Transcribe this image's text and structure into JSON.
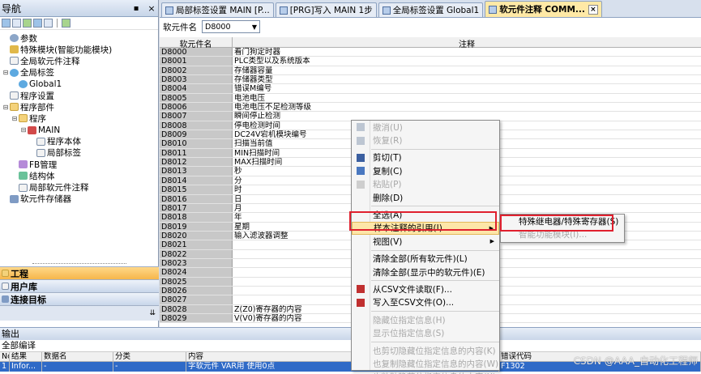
{
  "nav": {
    "title": "导航",
    "pin": "▪ ×",
    "tree": [
      {
        "label": "参数",
        "indent": 0,
        "toggle": "",
        "icon": "gear"
      },
      {
        "label": "特殊模块(智能功能模块)",
        "indent": 0,
        "toggle": "",
        "icon": "spec"
      },
      {
        "label": "全局软元件注释",
        "indent": 0,
        "toggle": "",
        "icon": "doc"
      },
      {
        "label": "全局标签",
        "indent": 0,
        "toggle": "-",
        "icon": "globe"
      },
      {
        "label": "Global1",
        "indent": 1,
        "toggle": "",
        "icon": "globe"
      },
      {
        "label": "程序设置",
        "indent": 0,
        "toggle": "",
        "icon": "doc"
      },
      {
        "label": "程序部件",
        "indent": 0,
        "toggle": "-",
        "icon": "folder"
      },
      {
        "label": "程序",
        "indent": 1,
        "toggle": "-",
        "icon": "folder"
      },
      {
        "label": "MAIN",
        "indent": 2,
        "toggle": "-",
        "icon": "prog"
      },
      {
        "label": "程序本体",
        "indent": 3,
        "toggle": "",
        "icon": "doc"
      },
      {
        "label": "局部标签",
        "indent": 3,
        "toggle": "",
        "icon": "doc"
      },
      {
        "label": "FB管理",
        "indent": 1,
        "toggle": "",
        "icon": "fb"
      },
      {
        "label": "结构体",
        "indent": 1,
        "toggle": "",
        "icon": "struct"
      },
      {
        "label": "局部软元件注释",
        "indent": 1,
        "toggle": "",
        "icon": "doc"
      },
      {
        "label": "软元件存储器",
        "indent": 0,
        "toggle": "",
        "icon": "mem"
      }
    ],
    "tabs": [
      {
        "label": "工程",
        "active": true
      },
      {
        "label": "用户库",
        "active": false
      },
      {
        "label": "连接目标",
        "active": false
      }
    ],
    "footer": "⇊"
  },
  "tabs": [
    {
      "label": "局部标签设置 MAIN [P...",
      "active": false
    },
    {
      "label": "[PRG]写入 MAIN 1步",
      "active": false
    },
    {
      "label": "全局标签设置 Global1",
      "active": false
    },
    {
      "label": "软元件注释 COMM...",
      "active": true
    }
  ],
  "selector": {
    "label": "软元件名",
    "value": "D8000"
  },
  "grid": {
    "col1": "软元件名",
    "col2": "注释",
    "rows": [
      {
        "dev": "D8000",
        "comment": "看门狗定时器"
      },
      {
        "dev": "D8001",
        "comment": "PLC类型以及系统版本"
      },
      {
        "dev": "D8002",
        "comment": "存储器容量"
      },
      {
        "dev": "D8003",
        "comment": "存储器类型"
      },
      {
        "dev": "D8004",
        "comment": "错误M编号"
      },
      {
        "dev": "D8005",
        "comment": "电池电压"
      },
      {
        "dev": "D8006",
        "comment": "电池电压不足检测等级"
      },
      {
        "dev": "D8007",
        "comment": "瞬间停止检测"
      },
      {
        "dev": "D8008",
        "comment": "停电检测时间"
      },
      {
        "dev": "D8009",
        "comment": "DC24V宕机模块编号"
      },
      {
        "dev": "D8010",
        "comment": "扫描当前值"
      },
      {
        "dev": "D8011",
        "comment": "MIN扫描时间"
      },
      {
        "dev": "D8012",
        "comment": "MAX扫描时间"
      },
      {
        "dev": "D8013",
        "comment": "秒"
      },
      {
        "dev": "D8014",
        "comment": "分"
      },
      {
        "dev": "D8015",
        "comment": "时"
      },
      {
        "dev": "D8016",
        "comment": "日"
      },
      {
        "dev": "D8017",
        "comment": "月"
      },
      {
        "dev": "D8018",
        "comment": "年"
      },
      {
        "dev": "D8019",
        "comment": "星期"
      },
      {
        "dev": "D8020",
        "comment": "输入滤波器调整"
      },
      {
        "dev": "D8021",
        "comment": ""
      },
      {
        "dev": "D8022",
        "comment": ""
      },
      {
        "dev": "D8023",
        "comment": ""
      },
      {
        "dev": "D8024",
        "comment": ""
      },
      {
        "dev": "D8025",
        "comment": ""
      },
      {
        "dev": "D8026",
        "comment": ""
      },
      {
        "dev": "D8027",
        "comment": ""
      },
      {
        "dev": "D8028",
        "comment": "Z(Z0)寄存器的内容"
      },
      {
        "dev": "D8029",
        "comment": "V(V0)寄存器的内容"
      }
    ]
  },
  "context_menu": {
    "items": [
      {
        "label": "撤消(U)",
        "disabled": true,
        "icon": "undo",
        "sep_after": false
      },
      {
        "label": "恢复(R)",
        "disabled": true,
        "icon": "redo",
        "sep_after": true
      },
      {
        "label": "剪切(T)",
        "disabled": false,
        "icon": "cut",
        "sep_after": false
      },
      {
        "label": "复制(C)",
        "disabled": false,
        "icon": "copy",
        "sep_after": false
      },
      {
        "label": "粘贴(P)",
        "disabled": true,
        "icon": "paste",
        "sep_after": false
      },
      {
        "label": "删除(D)",
        "disabled": false,
        "icon": "",
        "sep_after": true
      },
      {
        "label": "全选(A)",
        "disabled": false,
        "icon": "",
        "sep_after": false
      },
      {
        "label": "样本注释的引用(I)",
        "disabled": false,
        "icon": "",
        "submenu": true,
        "highlight": true,
        "sep_after": false
      },
      {
        "label": "视图(V)",
        "disabled": false,
        "icon": "",
        "submenu": true,
        "sep_after": true
      },
      {
        "label": "清除全部(所有软元件)(L)",
        "disabled": false,
        "icon": "",
        "sep_after": false
      },
      {
        "label": "清除全部(显示中的软元件)(E)",
        "disabled": false,
        "icon": "",
        "sep_after": true
      },
      {
        "label": "从CSV文件读取(F)...",
        "disabled": false,
        "icon": "csvin",
        "sep_after": false
      },
      {
        "label": "写入至CSV文件(O)...",
        "disabled": false,
        "icon": "csvout",
        "sep_after": true
      },
      {
        "label": "隐藏位指定信息(H)",
        "disabled": true,
        "icon": "",
        "sep_after": false
      },
      {
        "label": "显示位指定信息(S)",
        "disabled": true,
        "icon": "",
        "sep_after": true
      },
      {
        "label": "也剪切隐藏位指定信息的内容(K)",
        "disabled": true,
        "icon": "",
        "sep_after": false
      },
      {
        "label": "也复制隐藏位指定信息的内容(W)",
        "disabled": true,
        "icon": "",
        "sep_after": false
      },
      {
        "label": "也粘贴隐藏位指定信息的内容(X)",
        "disabled": true,
        "icon": "",
        "sep_after": false
      }
    ]
  },
  "submenu": {
    "items": [
      {
        "label": "特殊继电器/特殊寄存器(S)",
        "disabled": false
      },
      {
        "label": "智能功能模块(I)...",
        "disabled": true
      }
    ]
  },
  "output": {
    "title": "输出",
    "subtitle": "全部编译",
    "headers": [
      "No.",
      "结果",
      "数据名",
      "分类",
      "内容",
      "错误代码"
    ],
    "row": [
      "1",
      "Infor...",
      "-",
      "-",
      "字软元件 VAR用 使用0点",
      "F1302"
    ]
  },
  "watermark": "CSDN @AAA_自动化工程师",
  "colors": {
    "highlight_box": "#e0202e",
    "active_tab": "#ffe9a6",
    "selection": "#2f6ac7"
  }
}
